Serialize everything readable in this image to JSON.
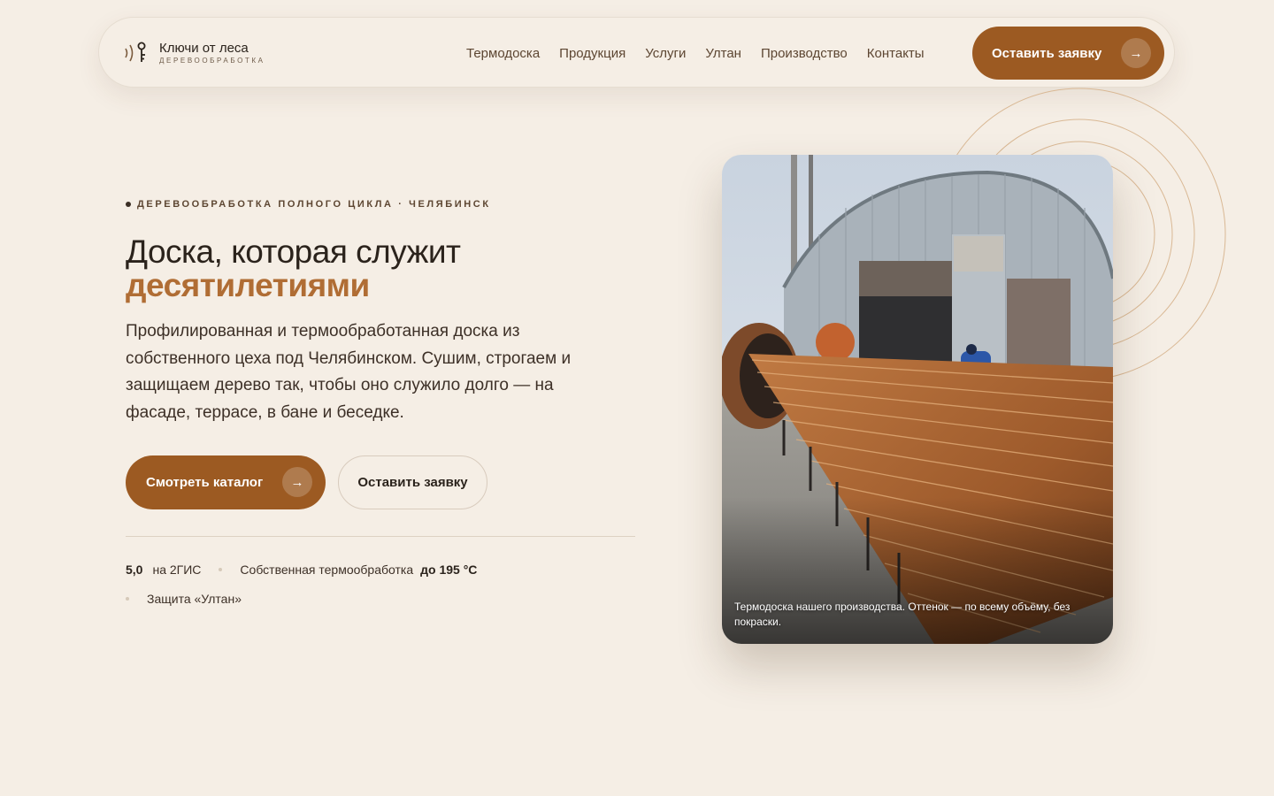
{
  "brand": {
    "name": "Ключи от леса",
    "tagline": "ДЕРЕВООБРАБОТКА",
    "accent_color": "#9c5a22",
    "highlight_color": "#b06d34",
    "background_color": "#f5eee5"
  },
  "nav": {
    "items": [
      {
        "label": "Термодоска"
      },
      {
        "label": "Продукция"
      },
      {
        "label": "Услуги"
      },
      {
        "label": "Ултан"
      },
      {
        "label": "Производство"
      },
      {
        "label": "Контакты"
      }
    ],
    "cta_label": "Оставить заявку",
    "cta_icon": "arrow-right-icon"
  },
  "hero": {
    "eyebrow": "ДЕРЕВООБРАБОТКА ПОЛНОГО ЦИКЛА · ЧЕЛЯБИНСК",
    "title_line1": "Доска, которая служит",
    "title_accent": "десятилетиями",
    "lead": "Профилированная и термообработанная доска из собственного цеха под Челябинском. Сушим, строгаем и защищаем дерево так, чтобы оно служило долго — на фасаде, террасе, в бане и беседке.",
    "primary_button": "Смотреть каталог",
    "secondary_button": "Оставить заявку",
    "stats": {
      "rating_value": "5,0",
      "rating_source": "на 2ГИС",
      "thermo_label": "Собственная термообработка",
      "thermo_value": "до 195 °C",
      "protection_label": "Защита «Ултан»"
    },
    "photo_caption": "Термодоска нашего производства. Оттенок — по всему объёму, без покраски."
  }
}
